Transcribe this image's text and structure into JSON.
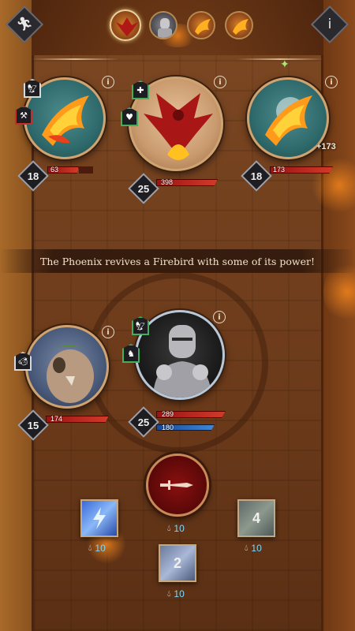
{
  "top_bar": {
    "flee_icon": "running-man-icon",
    "info_label": "i",
    "turn_order": [
      "phoenix",
      "knight",
      "firebird",
      "firebird"
    ]
  },
  "narration": "The Phoenix revives a Firebird with some of its power!",
  "enemies": [
    {
      "name": "firebird",
      "level": "18",
      "hp": "63",
      "hp_fraction": 0.35,
      "status_icons": [
        "eagle-icon",
        "scythe-icon"
      ]
    },
    {
      "name": "phoenix",
      "level": "25",
      "hp": "398",
      "hp_fraction": 0.8,
      "status_icons": [
        "heal-plus-icon",
        "heart-plant-icon"
      ]
    },
    {
      "name": "firebird",
      "level": "18",
      "hp": "173",
      "hp_fraction": 1.0,
      "heal_popup": "+173"
    }
  ],
  "allies": [
    {
      "name": "beast",
      "level": "15",
      "hp": "174",
      "hp_fraction": 1.0,
      "status_icons": [
        "boar-icon"
      ]
    },
    {
      "name": "knight",
      "level": "25",
      "hp": "289",
      "armor": "180",
      "hp_fraction": 1.0,
      "armor_fraction": 1.0,
      "status_icons": [
        "eagle-icon",
        "horse-icon"
      ]
    }
  ],
  "abilities": {
    "attack_icon": "sword-icon",
    "cards": [
      {
        "name": "lightning",
        "label": "",
        "cost": "10"
      },
      {
        "name": "rock",
        "label": "4",
        "cost": "10"
      },
      {
        "name": "shield",
        "label": "2",
        "cost": "10"
      }
    ]
  },
  "colors": {
    "hp": "#d23a2a",
    "armor": "#3a88d8",
    "mana": "#7ad8ff"
  }
}
